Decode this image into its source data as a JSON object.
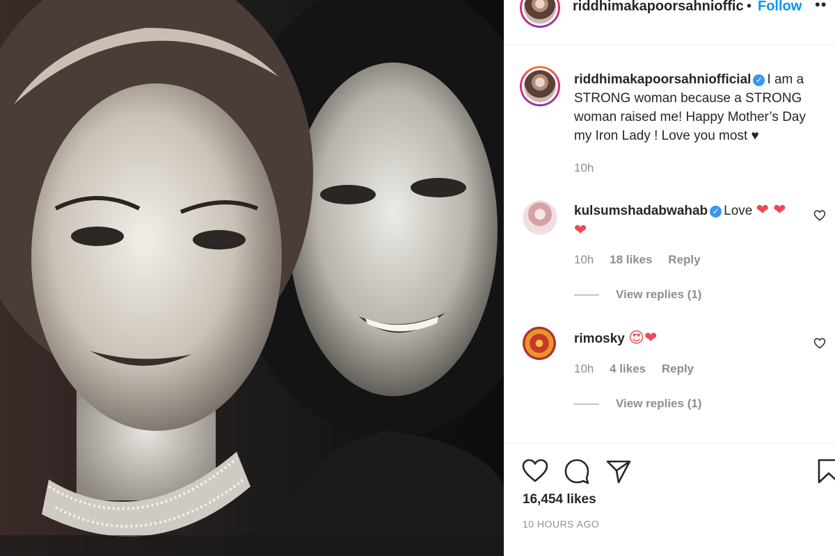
{
  "header": {
    "username": "riddhimakapoorsahnioffic",
    "dot": "•",
    "follow_label": "Follow",
    "more_label": "••"
  },
  "caption": {
    "username": "riddhimakapoorsahniofficial",
    "text": "I am a STRONG woman because a STRONG woman raised me! Happy Mother’s Day my Iron Lady ! Love you most ♥",
    "time": "10h"
  },
  "comments": [
    {
      "username": "kulsumshadabwahab",
      "text": "Love",
      "emoji": "❤ ❤ ❤",
      "time": "10h",
      "likes": "18 likes",
      "reply_label": "Reply",
      "view_replies": "View replies (1)"
    },
    {
      "username": "rimosky",
      "emoji": "😍❤",
      "time": "10h",
      "likes": "4 likes",
      "reply_label": "Reply",
      "view_replies": "View replies (1)"
    }
  ],
  "footer": {
    "likes": "16,454 likes",
    "ago": "10 HOURS AGO"
  },
  "icons": [
    "heart-icon",
    "comment-icon",
    "share-icon",
    "bookmark-icon",
    "verified-icon",
    "more-icon"
  ],
  "colors": {
    "accent": "#0095f6",
    "verified": "#3897f0",
    "heart": "#ed4956",
    "muted": "#8e8e8e",
    "text": "#262626"
  }
}
